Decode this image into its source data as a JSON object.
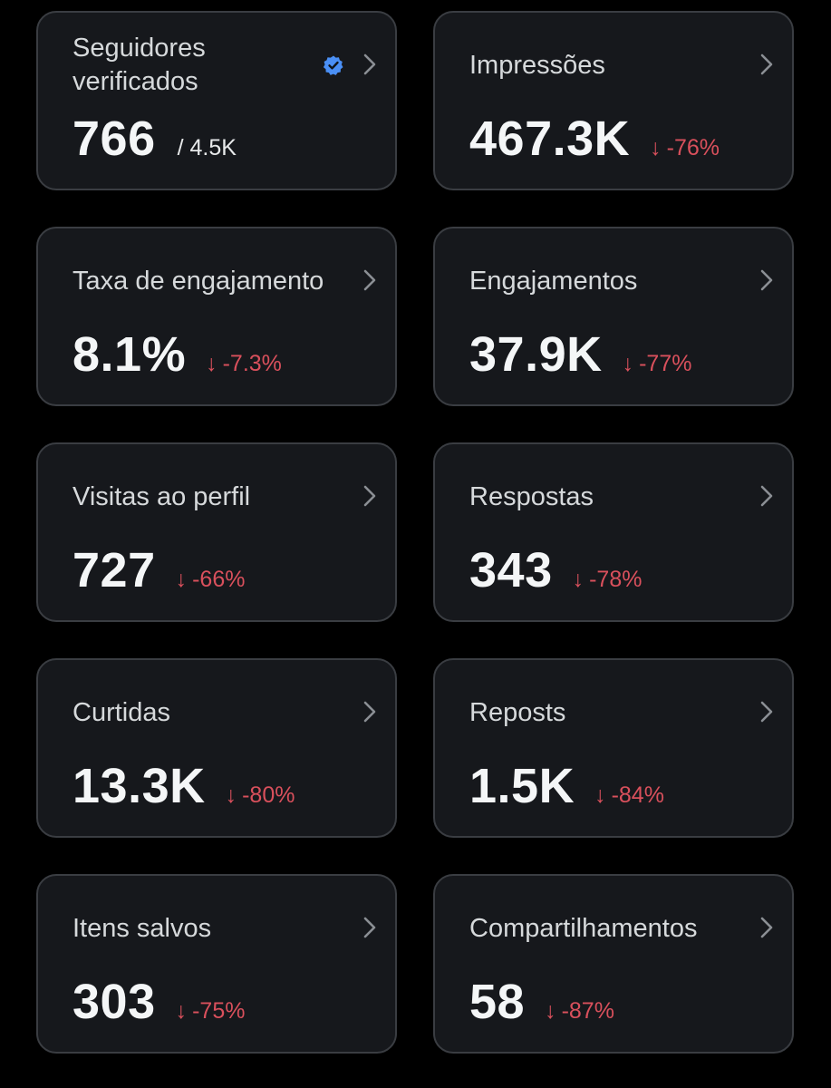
{
  "cards": [
    {
      "label": "Seguidores verificados",
      "value": "766",
      "suffix": "/ 4.5K",
      "verified": true
    },
    {
      "label": "Impressões",
      "value": "467.3K",
      "delta": "-76%"
    },
    {
      "label": "Taxa de engajamento",
      "value": "8.1%",
      "delta": "-7.3%"
    },
    {
      "label": "Engajamentos",
      "value": "37.9K",
      "delta": "-77%"
    },
    {
      "label": "Visitas ao perfil",
      "value": "727",
      "delta": "-66%"
    },
    {
      "label": "Respostas",
      "value": "343",
      "delta": "-78%"
    },
    {
      "label": "Curtidas",
      "value": "13.3K",
      "delta": "-80%"
    },
    {
      "label": "Reposts",
      "value": "1.5K",
      "delta": "-84%"
    },
    {
      "label": "Itens salvos",
      "value": "303",
      "delta": "-75%"
    },
    {
      "label": "Compartilhamentos",
      "value": "58",
      "delta": "-87%"
    }
  ],
  "icons": {
    "chevron": "chevron-right-icon",
    "verified": "verified-badge-icon",
    "down_arrow": "arrow-down-icon"
  },
  "colors": {
    "background": "#000000",
    "card": "#16181c",
    "card_border": "#3a3d42",
    "negative": "#d9505c",
    "verified": "#4a8ff5"
  }
}
